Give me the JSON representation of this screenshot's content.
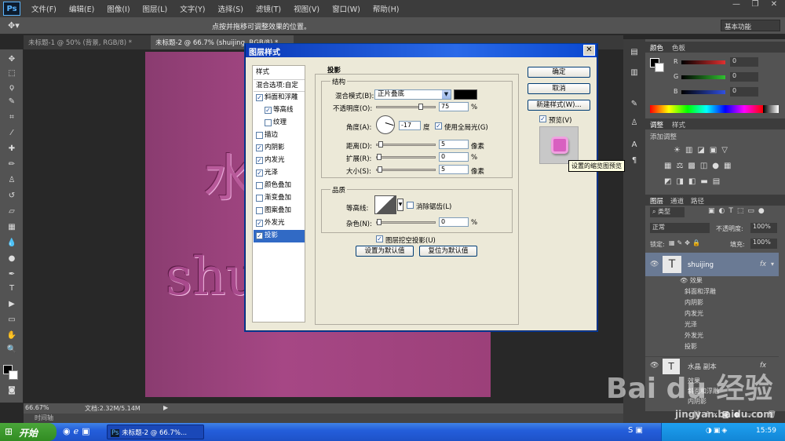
{
  "menubar": {
    "logo": "Ps",
    "items": [
      "文件(F)",
      "编辑(E)",
      "图像(I)",
      "图层(L)",
      "文字(Y)",
      "选择(S)",
      "滤镜(T)",
      "视图(V)",
      "窗口(W)",
      "帮助(H)"
    ]
  },
  "options": {
    "hint": "点按并拖移可调整效果的位置。",
    "workspace": "基本功能"
  },
  "tabs": [
    "未标题-1 @ 50% (背景, RGB/8) *",
    "未标题-2 @ 66.7% (shuijing, RGB/8) *"
  ],
  "canvas": {
    "text_top": "水",
    "text_bottom": "shu"
  },
  "status": {
    "zoom": "66.67%",
    "doc": "文档:2.32M/5.14M",
    "timeline": "时间轴"
  },
  "dialog": {
    "title": "图层样式",
    "styles_header": "样式",
    "blend_options": "混合选项:自定",
    "styles": [
      {
        "label": "斜面和浮雕",
        "checked": true,
        "indent": false
      },
      {
        "label": "等高线",
        "checked": true,
        "indent": true
      },
      {
        "label": "纹理",
        "checked": false,
        "indent": true
      },
      {
        "label": "描边",
        "checked": false,
        "indent": false
      },
      {
        "label": "内阴影",
        "checked": true,
        "indent": false
      },
      {
        "label": "内发光",
        "checked": true,
        "indent": false
      },
      {
        "label": "光泽",
        "checked": true,
        "indent": false
      },
      {
        "label": "颜色叠加",
        "checked": false,
        "indent": false
      },
      {
        "label": "渐变叠加",
        "checked": false,
        "indent": false
      },
      {
        "label": "图案叠加",
        "checked": false,
        "indent": false
      },
      {
        "label": "外发光",
        "checked": true,
        "indent": false
      },
      {
        "label": "投影",
        "checked": true,
        "indent": false,
        "selected": true
      }
    ],
    "section_title": "投影",
    "structure_title": "结构",
    "blend_mode_label": "混合模式(B):",
    "blend_mode": "正片叠底",
    "opacity_label": "不透明度(O):",
    "opacity": "75",
    "opacity_pct": 0.75,
    "percent": "%",
    "angle_label": "角度(A):",
    "angle": "-17",
    "degree": "度",
    "global_light": "使用全局光(G)",
    "distance_label": "距离(D):",
    "distance": "5",
    "spread_label": "扩展(R):",
    "spread": "0",
    "size_label": "大小(S):",
    "size": "5",
    "px": "像素",
    "quality_title": "品质",
    "contour_label": "等高线:",
    "anti_alias": "消除锯齿(L)",
    "noise_label": "杂色(N):",
    "noise": "0",
    "knockout": "图层挖空投影(U)",
    "set_default": "设置为默认值",
    "reset_default": "复位为默认值",
    "ok": "确定",
    "cancel": "取消",
    "new_style": "新建样式(W)...",
    "preview": "预览(V)",
    "tooltip": "设置的缩览图预览",
    "shadow_color": "#000000"
  },
  "panels": {
    "color_tabs": [
      "颜色",
      "色板"
    ],
    "channels": [
      {
        "label": "R",
        "value": "0",
        "color": "#e03030"
      },
      {
        "label": "G",
        "value": "0",
        "color": "#30c030"
      },
      {
        "label": "B",
        "value": "0",
        "color": "#3050e0"
      }
    ],
    "adjust_tabs": [
      "调整",
      "样式"
    ],
    "adjust_hint": "添加调整",
    "layer_tabs": [
      "图层",
      "通道",
      "路径"
    ],
    "filter": "类型",
    "blend": "正常",
    "opacity_label": "不透明度:",
    "opacity": "100%",
    "lock_label": "锁定:",
    "fill_label": "填充:",
    "fill": "100%",
    "layer1": "shuijing",
    "fx": "fx",
    "effects_label": "效果",
    "effects": [
      "斜面和浮雕",
      "内阴影",
      "内发光",
      "光泽",
      "外发光",
      "投影"
    ],
    "layer2": "水晶 副本",
    "effects2": [
      "效果",
      "斜面和浮雕",
      "内阴影"
    ]
  },
  "watermark": {
    "brand": "Bai du 经验",
    "url": "jingyan.baidu.com"
  },
  "taskbar": {
    "start": "开始",
    "task": "未标题-2 @ 66.7%...",
    "time": "15:59"
  }
}
